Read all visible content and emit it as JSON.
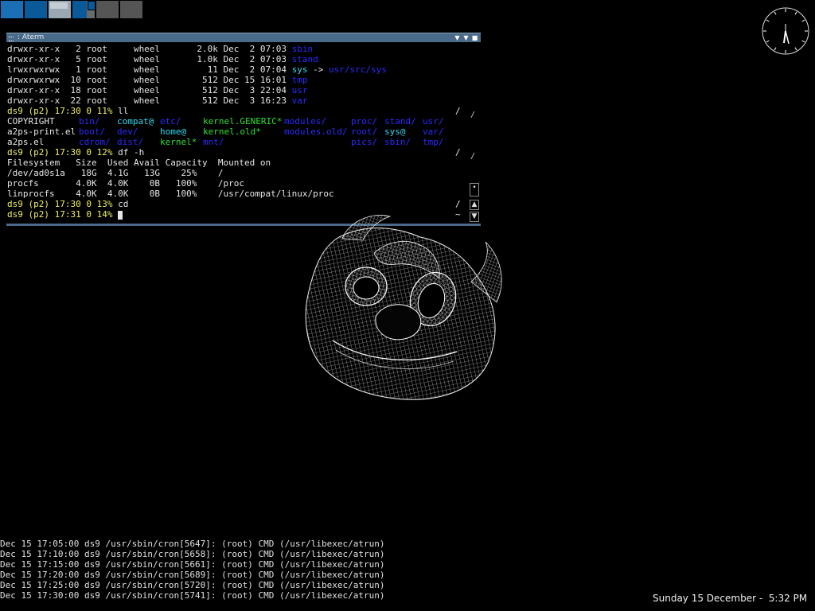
{
  "terminal": {
    "title": ": Aterm",
    "buttons": {
      "shade": "▼",
      "iconify": "▼",
      "close": "■"
    },
    "listing": [
      {
        "perms": "drwxr-xr-x",
        "links": " 2",
        "owner": "root",
        "group": "wheel",
        "size": "2.0k",
        "date": "Dec  2 07:03",
        "name": "sbin",
        "name_color": "blue",
        "target": ""
      },
      {
        "perms": "drwxr-xr-x",
        "links": " 5",
        "owner": "root",
        "group": "wheel",
        "size": "1.0k",
        "date": "Dec  2 07:03",
        "name": "stand",
        "name_color": "blue",
        "target": ""
      },
      {
        "perms": "lrwxrwxrwx",
        "links": " 1",
        "owner": "root",
        "group": "wheel",
        "size": "  11",
        "date": "Dec  2 07:04",
        "name": "sys",
        "name_color": "cyan",
        "target": "usr/src/sys"
      },
      {
        "perms": "drwxrwxrwx",
        "links": "10",
        "owner": "root",
        "group": "wheel",
        "size": " 512",
        "date": "Dec 15 16:01",
        "name": "tmp",
        "name_color": "blue",
        "target": ""
      },
      {
        "perms": "drwxr-xr-x",
        "links": "18",
        "owner": "root",
        "group": "wheel",
        "size": " 512",
        "date": "Dec  3 22:04",
        "name": "usr",
        "name_color": "blue",
        "target": ""
      },
      {
        "perms": "drwxr-xr-x",
        "links": "22",
        "owner": "root",
        "group": "wheel",
        "size": " 512",
        "date": "Dec  3 16:23",
        "name": "var",
        "name_color": "blue",
        "target": ""
      }
    ],
    "prompt1": {
      "prompt": "ds9 (p2) 17:30 0 11%",
      "command": "ll",
      "right": "/"
    },
    "ll_rows": [
      [
        {
          "t": "COPYRIGHT",
          "c": "white"
        },
        {
          "t": "bin/",
          "c": "blue"
        },
        {
          "t": "compat@",
          "c": "cyan"
        },
        {
          "t": "etc/",
          "c": "blue"
        },
        {
          "t": "kernel.GENERIC*",
          "c": "green"
        },
        {
          "t": "modules/",
          "c": "blue"
        },
        {
          "t": "proc/",
          "c": "blue"
        },
        {
          "t": "stand/",
          "c": "blue"
        },
        {
          "t": "usr/",
          "c": "blue"
        }
      ],
      [
        {
          "t": "a2ps-print.el",
          "c": "white"
        },
        {
          "t": "boot/",
          "c": "blue"
        },
        {
          "t": "dev/",
          "c": "blue"
        },
        {
          "t": "home@",
          "c": "cyan"
        },
        {
          "t": "kernel.old*",
          "c": "green"
        },
        {
          "t": "modules.old/",
          "c": "blue"
        },
        {
          "t": "root/",
          "c": "blue"
        },
        {
          "t": "sys@",
          "c": "cyan"
        },
        {
          "t": "var/",
          "c": "blue"
        }
      ],
      [
        {
          "t": "a2ps.el",
          "c": "white"
        },
        {
          "t": "cdrom/",
          "c": "blue"
        },
        {
          "t": "dist/",
          "c": "blue"
        },
        {
          "t": "kernel*",
          "c": "green"
        },
        {
          "t": "mnt/",
          "c": "blue"
        },
        {
          "t": "",
          "c": "blue"
        },
        {
          "t": "pics/",
          "c": "blue"
        },
        {
          "t": "sbin/",
          "c": "blue"
        },
        {
          "t": "tmp/",
          "c": "blue"
        }
      ]
    ],
    "prompt2": {
      "prompt": "ds9 (p2) 17:30 0 12%",
      "command": "df -h",
      "right": "/"
    },
    "df_header": [
      "Filesystem",
      "Size",
      "Used",
      "Avail",
      "Capacity",
      "Mounted on"
    ],
    "df_rows": [
      [
        "/dev/ad0s1a",
        "18G",
        "4.1G",
        "13G",
        "25%",
        "/"
      ],
      [
        "procfs",
        "4.0K",
        "4.0K",
        "0B",
        "100%",
        "/proc"
      ],
      [
        "linprocfs",
        "4.0K",
        "4.0K",
        "0B",
        "100%",
        "/usr/compat/linux/proc"
      ]
    ],
    "prompt3": {
      "prompt": "ds9 (p2) 17:30 0 13%",
      "command": "cd",
      "right": "/"
    },
    "prompt4": {
      "prompt": "ds9 (p2) 17:31 0 14%",
      "command": "",
      "right": "~"
    }
  },
  "log_lines": [
    "Dec 15 17:05:00 ds9 /usr/sbin/cron[5647]: (root) CMD (/usr/libexec/atrun)",
    "Dec 15 17:10:00 ds9 /usr/sbin/cron[5658]: (root) CMD (/usr/libexec/atrun)",
    "Dec 15 17:15:00 ds9 /usr/sbin/cron[5661]: (root) CMD (/usr/libexec/atrun)",
    "Dec 15 17:20:00 ds9 /usr/sbin/cron[5689]: (root) CMD (/usr/libexec/atrun)",
    "Dec 15 17:25:00 ds9 /usr/sbin/cron[5720]: (root) CMD (/usr/libexec/atrun)",
    "Dec 15 17:30:00 ds9 /usr/sbin/cron[5741]: (root) CMD (/usr/libexec/atrun)"
  ],
  "datetime": "Sunday 15 December -  5:32 PM",
  "colors": {
    "titlebar": "#4a6a8a",
    "dir": "#2a2aff",
    "link": "#30d8f0",
    "exec": "#30e030",
    "prompt": "#f0f060"
  }
}
